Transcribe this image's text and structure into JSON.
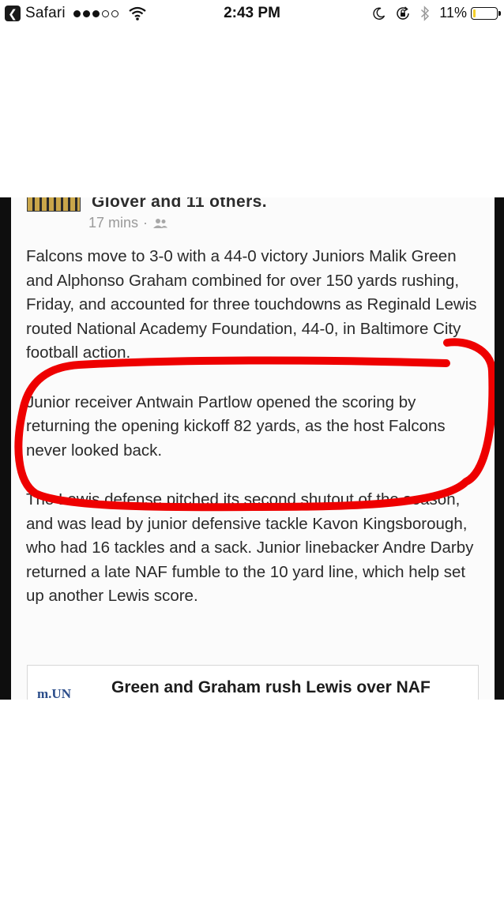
{
  "status_bar": {
    "back_app": "Safari",
    "signal_dots_filled": 3,
    "signal_dots_total": 5,
    "time": "2:43 PM",
    "battery_percent": "11%",
    "battery_level": 0.11,
    "icons": [
      "back-arrow-icon",
      "wifi-icon",
      "moon-icon",
      "rotation-lock-icon",
      "bluetooth-icon",
      "battery-icon"
    ]
  },
  "post": {
    "author": "Glover and 11 others.",
    "time": "17 mins",
    "meta_separator": "·",
    "privacy_icon": "friends-icon",
    "paragraphs": [
      "Falcons move to 3-0 with a 44-0 victory Juniors Malik Green and Alphonso Graham combined for over 150 yards rushing, Friday, and accounted for three touchdowns as Reginald Lewis routed National Academy Foundation, 44-0, in Baltimore City football action.",
      "Junior receiver Antwain Partlow opened the scoring by returning the opening kickoff 82 yards, as the host Falcons never looked back.",
      "The Lewis defense pitched its second shutout of the season, and was lead by junior defensive tackle Kavon Kingsborough, who had 16 tackles and a sack. Junior linebacker Andre Darby returned a late NAF fumble to the 10 yard line, which help set up another Lewis score."
    ],
    "link_card": {
      "thumb_text": "m.UN",
      "title": "Green and Graham rush Lewis over NAF"
    }
  },
  "colors": {
    "annotation": "#ee0000",
    "battery_fill": "#f4cf2a"
  }
}
